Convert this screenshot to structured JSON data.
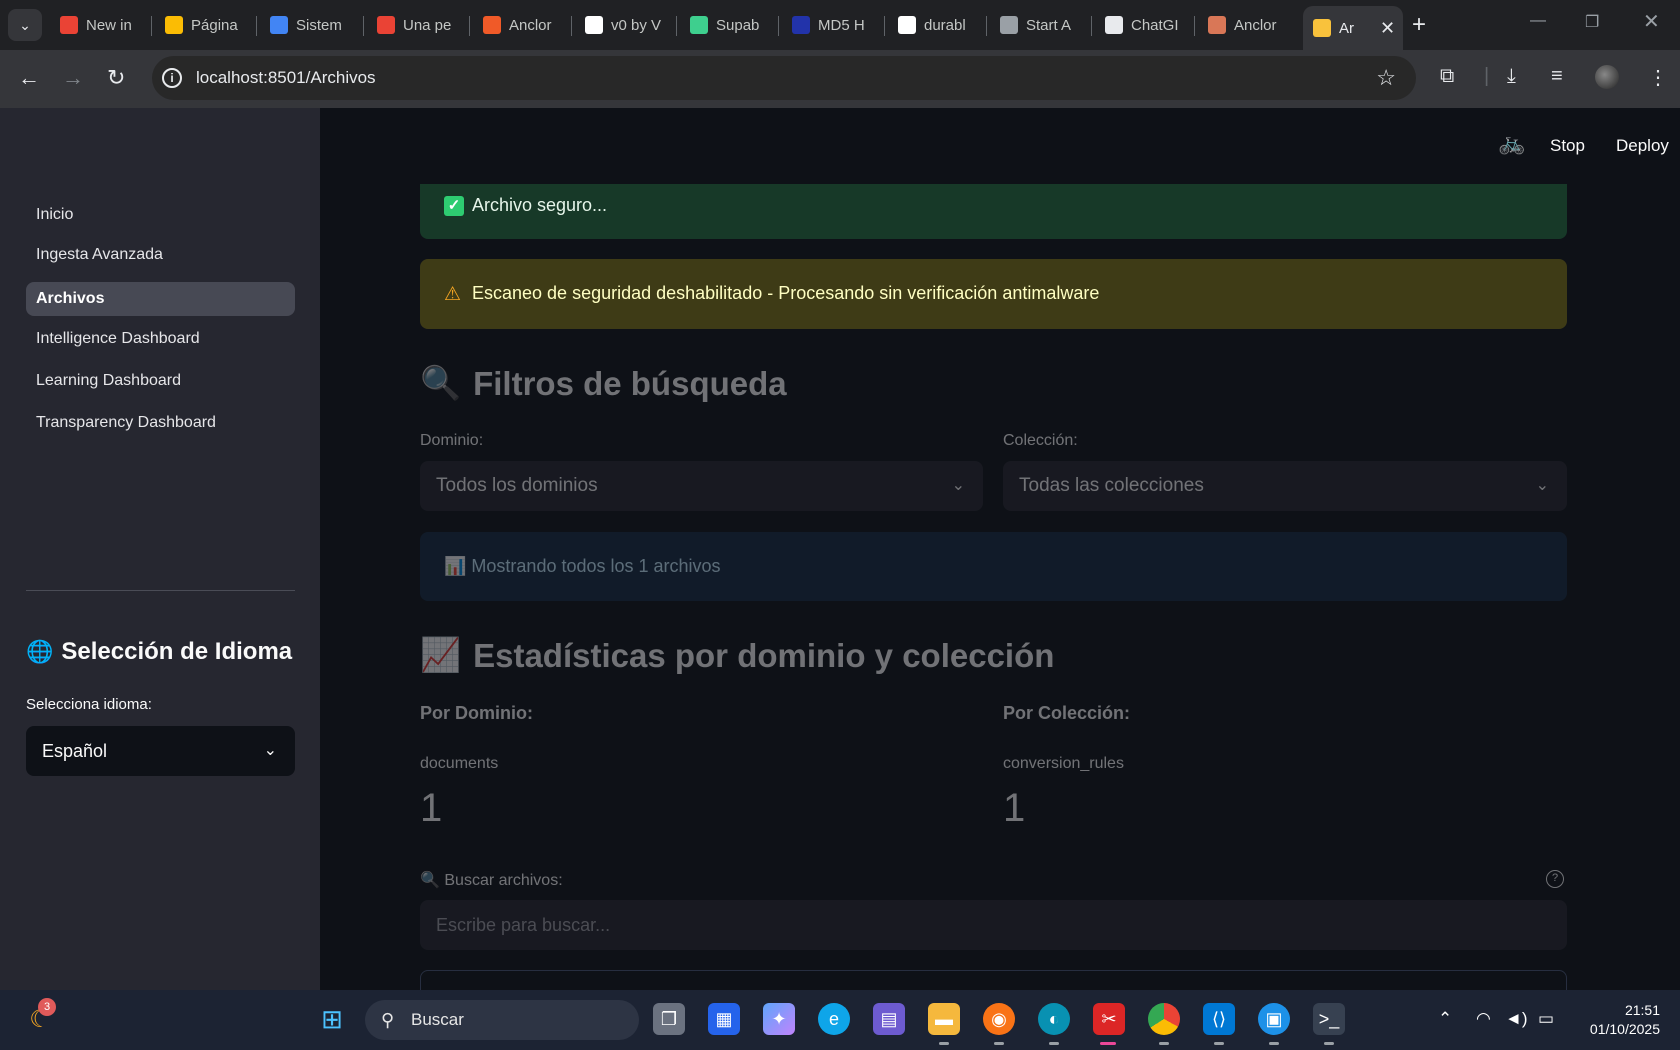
{
  "browser": {
    "tabs": [
      {
        "title": "New in",
        "icon": "gmail-icon",
        "color": "#ea4335"
      },
      {
        "title": "Página",
        "icon": "drive-icon",
        "color": "#fbbc04"
      },
      {
        "title": "Sistem",
        "icon": "docs-icon",
        "color": "#4285f4"
      },
      {
        "title": "Una pe",
        "icon": "gmail-icon",
        "color": "#ea4335"
      },
      {
        "title": "Anclor",
        "icon": "bolt-icon",
        "color": "#f05a28"
      },
      {
        "title": "v0 by V",
        "icon": "v0-icon",
        "color": "#ffffff"
      },
      {
        "title": "Supab",
        "icon": "supabase-icon",
        "color": "#3ecf8e"
      },
      {
        "title": "MD5 H",
        "icon": "md5-icon",
        "color": "#2233aa"
      },
      {
        "title": "durabl",
        "icon": "google-icon",
        "color": "#ffffff"
      },
      {
        "title": "Start A",
        "icon": "diamond-icon",
        "color": "#9aa0a6"
      },
      {
        "title": "ChatGI",
        "icon": "openai-icon",
        "color": "#e8eaed"
      },
      {
        "title": "Anclor",
        "icon": "claude-icon",
        "color": "#d97757"
      },
      {
        "title": "Ar",
        "icon": "folder-icon",
        "color": "#f9c23c"
      }
    ],
    "url": "localhost:8501/Archivos"
  },
  "sidebar": {
    "items": [
      {
        "label": "Inicio",
        "active": false
      },
      {
        "label": "Ingesta Avanzada",
        "active": false
      },
      {
        "label": "Archivos",
        "active": true
      },
      {
        "label": "Intelligence Dashboard",
        "active": false
      },
      {
        "label": "Learning Dashboard",
        "active": false
      },
      {
        "label": "Transparency Dashboard",
        "active": false
      }
    ],
    "language_title": "Selección de Idioma",
    "language_label": "Selecciona idioma:",
    "language_value": "Español"
  },
  "header": {
    "stop_label": "Stop",
    "deploy_label": "Deploy"
  },
  "main": {
    "success_text": "Archivo seguro...",
    "warning_text": "Escaneo de seguridad deshabilitado - Procesando sin verificación antimalware",
    "filters_title": "Filtros de búsqueda",
    "domain_label": "Dominio:",
    "domain_value": "Todos los dominios",
    "collection_label": "Colección:",
    "collection_value": "Todas las colecciones",
    "info_text": "Mostrando todos los 1 archivos",
    "stats_title": "Estadísticas por dominio y colección",
    "by_domain_label": "Por Dominio:",
    "by_collection_label": "Por Colección:",
    "domain_stat_key": "documents",
    "domain_stat_value": "1",
    "collection_stat_key": "conversion_rules",
    "collection_stat_value": "1",
    "search_label": "Buscar archivos:",
    "search_placeholder": "Escribe para buscar..."
  },
  "taskbar": {
    "search_placeholder": "Buscar",
    "notification_count": "3",
    "time": "21:51",
    "date": "01/10/2025"
  },
  "colors": {
    "success_bg": "#173928",
    "warning_bg": "#3e3b16",
    "info_bg": "#172d43",
    "sidebar_bg": "#262730",
    "main_bg": "#0e1117"
  }
}
